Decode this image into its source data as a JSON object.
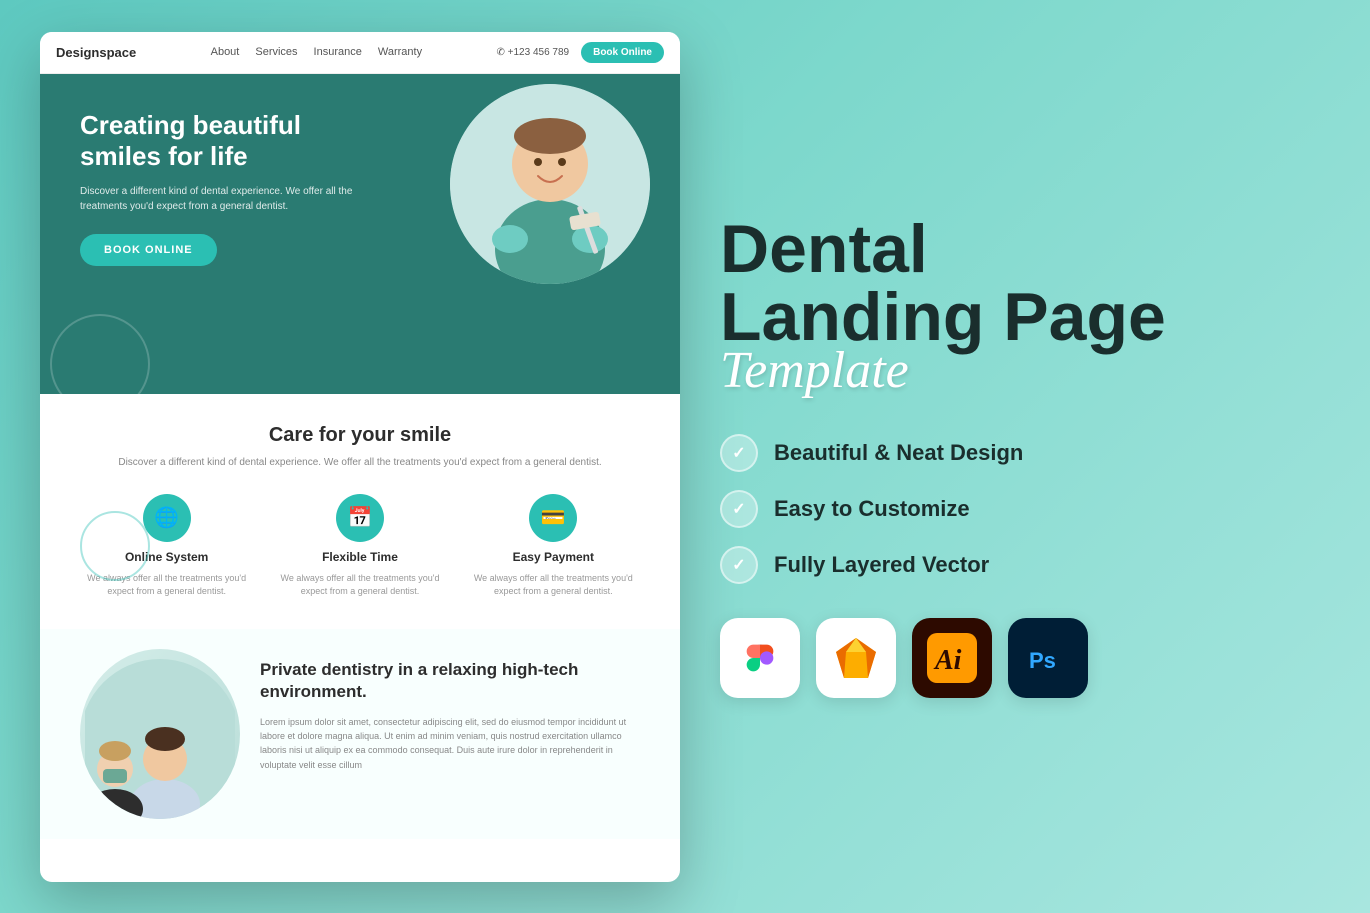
{
  "browser": {
    "brand": "Designspace",
    "nav": [
      "About",
      "Services",
      "Insurance",
      "Warranty"
    ],
    "phone": "✆ +123 456 789",
    "cta": "Book Online"
  },
  "hero": {
    "title": "Creating beautiful smiles for life",
    "description": "Discover a different kind of dental experience. We offer all the treatments you'd expect from a general dentist.",
    "cta_label": "BOOK ONLINE"
  },
  "services_section": {
    "title": "Care for your smile",
    "description": "Discover a different kind of dental experience. We offer all the treatments you'd expect from a general dentist.",
    "items": [
      {
        "name": "Online System",
        "text": "We always offer all the treatments you'd expect from a general dentist.",
        "icon": "🌐"
      },
      {
        "name": "Flexible Time",
        "text": "We always offer all the treatments you'd expect from a general dentist.",
        "icon": "📅"
      },
      {
        "name": "Easy Payment",
        "text": "We always offer all the treatments you'd expect from a general dentist.",
        "icon": "💳"
      }
    ]
  },
  "bottom": {
    "title": "Private dentistry in a relaxing high-tech environment.",
    "text": "Lorem ipsum dolor sit amet, consectetur adipiscing elit, sed do eiusmod tempor incididunt ut labore et dolore magna aliqua. Ut enim ad minim veniam, quis nostrud exercitation ullamco laboris nisi ut aliquip ex ea commodo consequat. Duis aute irure dolor in reprehenderit in voluptate velit esse cillum"
  },
  "right_panel": {
    "title_line1": "Dental",
    "title_line2": "Landing Page",
    "script_title": "Template",
    "features": [
      "Beautiful & Neat Design",
      "Easy to Customize",
      "Fully Layered Vector"
    ],
    "apps": [
      {
        "name": "Figma",
        "icon": "figma"
      },
      {
        "name": "Sketch",
        "icon": "sketch"
      },
      {
        "name": "Illustrator",
        "icon": "illustrator"
      },
      {
        "name": "Photoshop",
        "icon": "photoshop"
      }
    ]
  }
}
